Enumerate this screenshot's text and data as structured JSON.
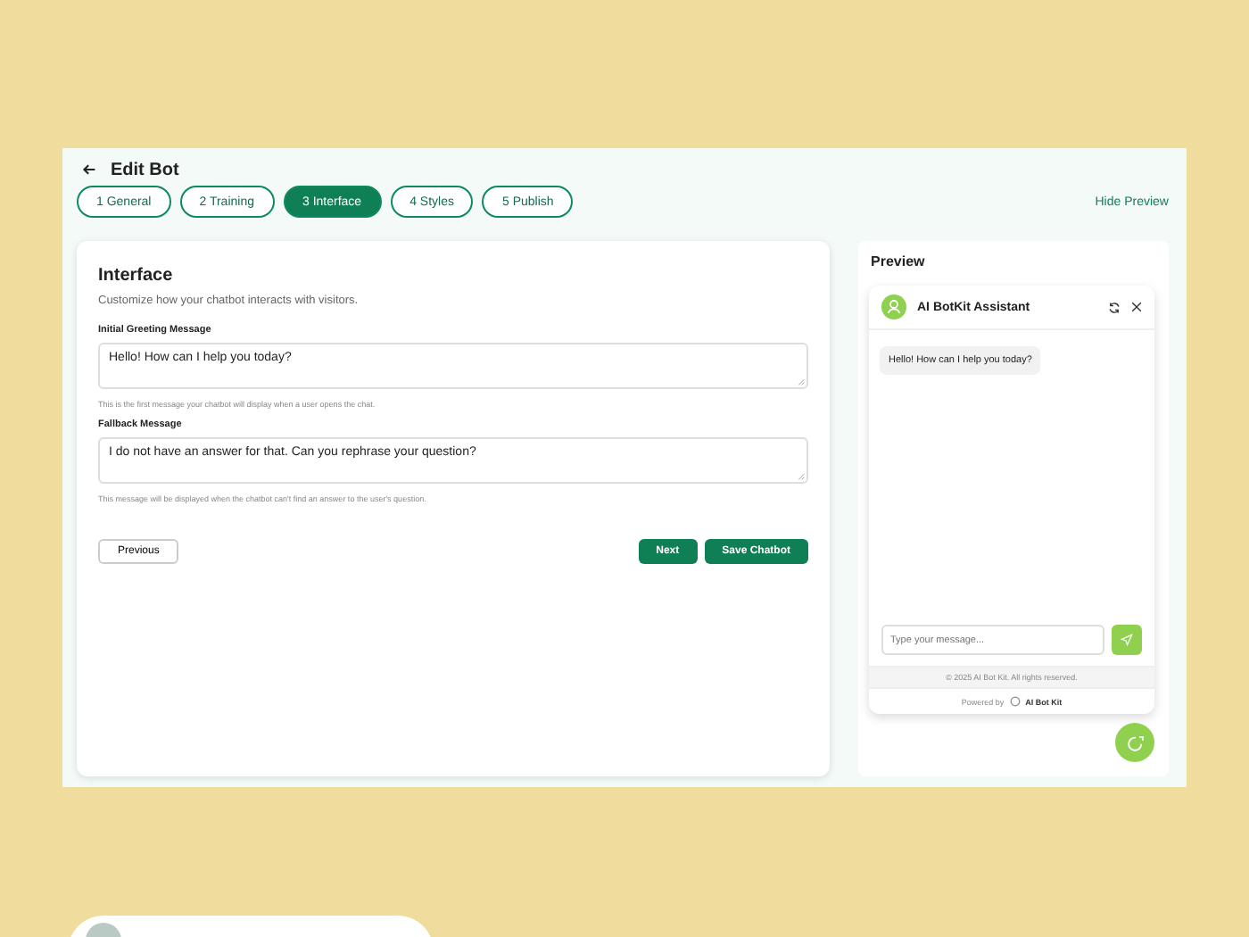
{
  "header": {
    "title": "Edit Bot"
  },
  "tabs": [
    {
      "label": "1 General",
      "selected": false
    },
    {
      "label": "2 Training",
      "selected": false
    },
    {
      "label": "3 Interface",
      "selected": true
    },
    {
      "label": "4 Styles",
      "selected": false
    },
    {
      "label": "5 Publish",
      "selected": false
    }
  ],
  "hide_preview": "Hide Preview",
  "form": {
    "title": "Interface",
    "subtitle": "Customize how your chatbot interacts with visitors.",
    "fields": [
      {
        "label": "Initial Greeting Message",
        "value": "Hello! How can I help you today?",
        "hint": "This is the first message your chatbot will display when a user opens the chat."
      },
      {
        "label": "Fallback Message",
        "value": "I do not have an answer for that. Can you rephrase your question?",
        "hint": "This message will be displayed when the chatbot can't find an answer to the user's question."
      }
    ],
    "buttons": {
      "previous": "Previous",
      "next": "Next",
      "save": "Save Chatbot"
    }
  },
  "preview": {
    "title": "Preview",
    "bot_name": "AI BotKit Assistant",
    "messages": [
      "Hello! How can I help you today?"
    ],
    "input": {
      "placeholder": "Type your message..."
    },
    "copyright": "© 2025 AI Bot Kit. All rights reserved.",
    "powered_by": "Powered by",
    "brand": "AI Bot Kit"
  }
}
